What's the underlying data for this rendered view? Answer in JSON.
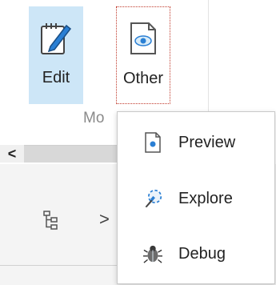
{
  "ribbon": {
    "buttons": [
      {
        "label": "Edit",
        "icon": "edit-icon"
      },
      {
        "label": "Other",
        "icon": "other-eye-document-icon"
      }
    ],
    "group_label": "Mo"
  },
  "scroll": {
    "left_arrow": "<"
  },
  "lower": {
    "chevron": ">",
    "tree_icon": "tree-icon"
  },
  "menu": {
    "items": [
      {
        "label": "Preview",
        "icon": "preview-icon"
      },
      {
        "label": "Explore",
        "icon": "explore-icon"
      },
      {
        "label": "Debug",
        "icon": "debug-bug-icon"
      }
    ]
  },
  "colors": {
    "selected_bg": "#cde6f7",
    "accent_blue": "#2a7fd4",
    "focus_dotted": "#c0392b"
  }
}
